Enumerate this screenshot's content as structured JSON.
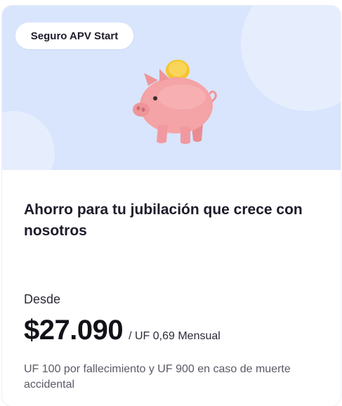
{
  "card": {
    "badge": "Seguro APV Start",
    "illustration_icon": "piggy-bank-coin-icon",
    "title": "Ahorro para tu jubilación que crece con nosotros",
    "from_label": "Desde",
    "price": "$27.090",
    "price_detail": "/ UF 0,69 Mensual",
    "coverage_note": "UF 100 por fallecimiento y UF 900 en caso de muerte accidental"
  },
  "colors": {
    "hero_background": "#d9e5fd",
    "pig": "#f4a3a6",
    "coin": "#f7c531",
    "text_primary": "#1c1c2a",
    "text_secondary": "#5a5a66"
  }
}
